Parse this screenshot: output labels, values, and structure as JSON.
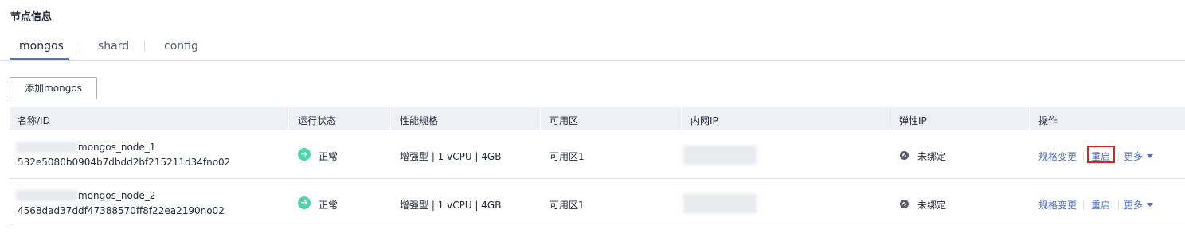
{
  "section": {
    "title": "节点信息"
  },
  "tabs": [
    {
      "label": "mongos",
      "active": true
    },
    {
      "label": "shard",
      "active": false
    },
    {
      "label": "config",
      "active": false
    }
  ],
  "toolbar": {
    "add_label": "添加mongos"
  },
  "table": {
    "headers": {
      "name": "名称/ID",
      "status": "运行状态",
      "spec": "性能规格",
      "az": "可用区",
      "private_ip": "内网IP",
      "eip": "弹性IP",
      "actions": "操作"
    },
    "rows": [
      {
        "name": "mongos_node_1",
        "id": "532e5080b0904b7dbdd2bf215211d34fno02",
        "status": "正常",
        "spec": "增强型 | 1 vCPU | 4GB",
        "az": "可用区1",
        "eip": "未绑定",
        "actions": {
          "resize": "规格变更",
          "restart": "重启",
          "more": "更多"
        }
      },
      {
        "name": "mongos_node_2",
        "id": "4568dad37ddf47388570ff8f22ea2190no02",
        "status": "正常",
        "spec": "增强型 | 1 vCPU | 4GB",
        "az": "可用区1",
        "eip": "未绑定",
        "actions": {
          "resize": "规格变更",
          "restart": "重启",
          "more": "更多"
        }
      }
    ]
  },
  "colors": {
    "accent": "#526ecc",
    "status_normal": "#50d4ab",
    "highlight": "#e0201c",
    "header_bg": "#eef0f5"
  }
}
